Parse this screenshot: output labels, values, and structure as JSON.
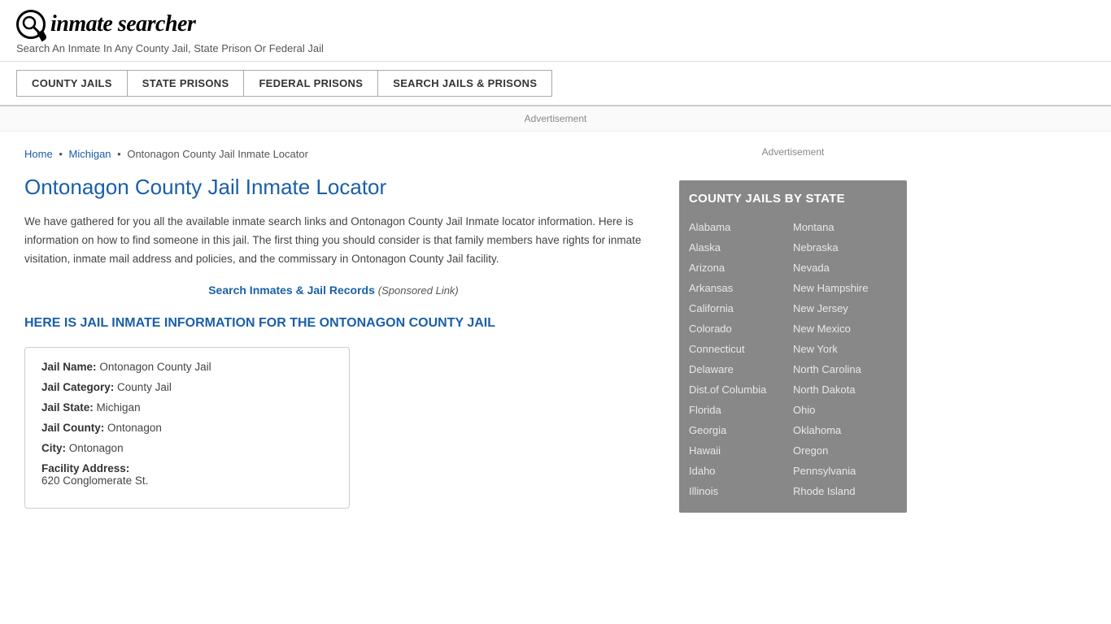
{
  "header": {
    "logo_symbol": "🔍",
    "logo_text": "inmate searcher",
    "tagline": "Search An Inmate In Any County Jail, State Prison Or Federal Jail"
  },
  "nav": {
    "buttons": [
      {
        "id": "county-jails",
        "label": "COUNTY JAILS"
      },
      {
        "id": "state-prisons",
        "label": "STATE PRISONS"
      },
      {
        "id": "federal-prisons",
        "label": "FEDERAL PRISONS"
      },
      {
        "id": "search-jails",
        "label": "SEARCH JAILS & PRISONS"
      }
    ]
  },
  "advertisement_label": "Advertisement",
  "breadcrumb": {
    "home": "Home",
    "state": "Michigan",
    "current": "Ontonagon County Jail Inmate Locator"
  },
  "page_title": "Ontonagon County Jail Inmate Locator",
  "description": "We have gathered for you all the available inmate search links and Ontonagon County Jail Inmate locator information. Here is information on how to find someone in this jail. The first thing you should consider is that family members have rights for inmate visitation, inmate mail address and policies, and the commissary in Ontonagon County Jail facility.",
  "sponsored_link": {
    "text": "Search Inmates & Jail Records",
    "label": "(Sponsored Link)"
  },
  "section_heading": "HERE IS JAIL INMATE INFORMATION FOR THE ONTONAGON COUNTY JAIL",
  "jail_info": {
    "name_label": "Jail Name:",
    "name_value": "Ontonagon County Jail",
    "category_label": "Jail Category:",
    "category_value": "County Jail",
    "state_label": "Jail State:",
    "state_value": "Michigan",
    "county_label": "Jail County:",
    "county_value": "Ontonagon",
    "city_label": "City:",
    "city_value": "Ontonagon",
    "address_label": "Facility Address:",
    "address_value": "620 Conglomerate St."
  },
  "sidebar": {
    "ad_label": "Advertisement",
    "county_jails_title": "COUNTY JAILS BY STATE",
    "states_col1": [
      "Alabama",
      "Alaska",
      "Arizona",
      "Arkansas",
      "California",
      "Colorado",
      "Connecticut",
      "Delaware",
      "Dist.of Columbia",
      "Florida",
      "Georgia",
      "Hawaii",
      "Idaho",
      "Illinois"
    ],
    "states_col2": [
      "Montana",
      "Nebraska",
      "Nevada",
      "New Hampshire",
      "New Jersey",
      "New Mexico",
      "New York",
      "North Carolina",
      "North Dakota",
      "Ohio",
      "Oklahoma",
      "Oregon",
      "Pennsylvania",
      "Rhode Island"
    ]
  }
}
